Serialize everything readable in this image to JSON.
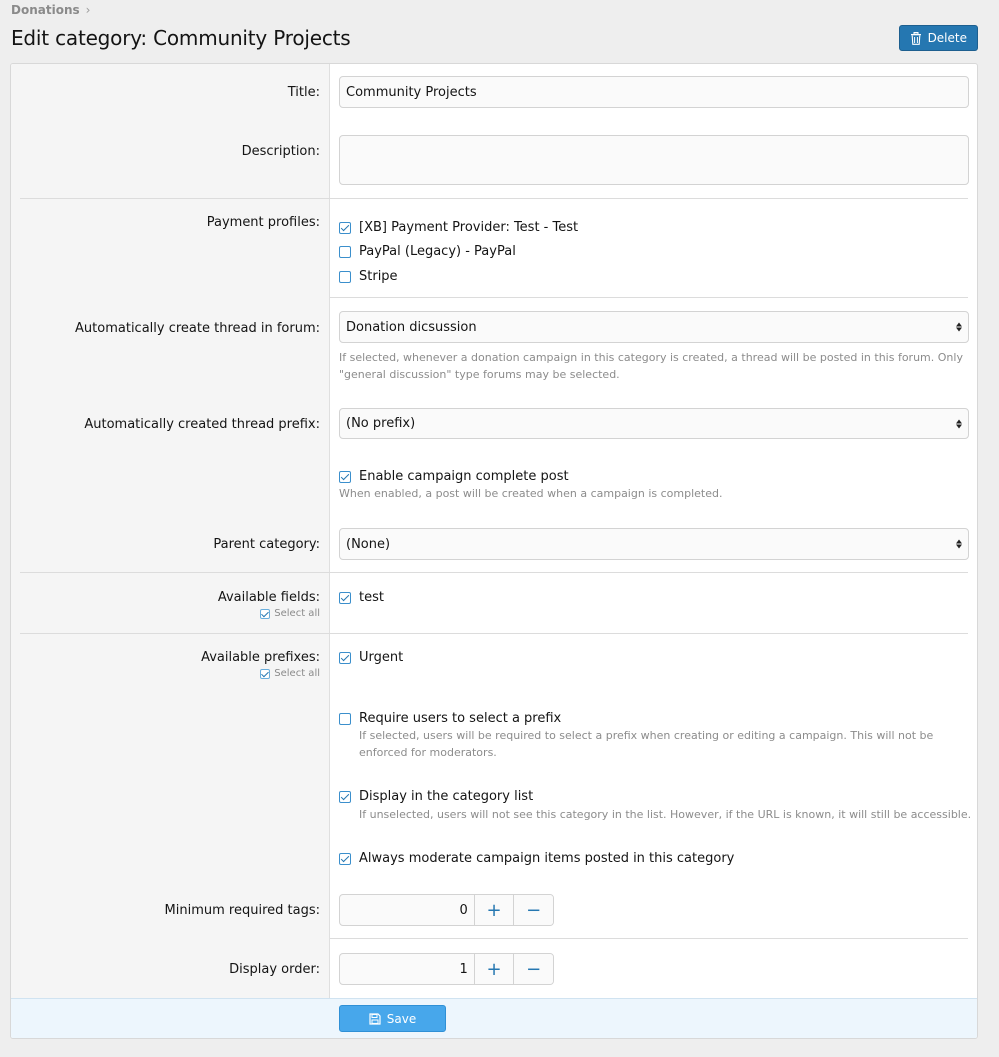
{
  "breadcrumb": {
    "item": "Donations"
  },
  "page": {
    "title": "Edit category: Community Projects"
  },
  "toolbar": {
    "delete_label": "Delete"
  },
  "form": {
    "title": {
      "label": "Title:",
      "value": "Community Projects"
    },
    "description": {
      "label": "Description:",
      "value": ""
    },
    "payment_profiles": {
      "label": "Payment profiles:",
      "options": [
        {
          "label": "[XB] Payment Provider: Test - Test",
          "checked": true
        },
        {
          "label": "PayPal (Legacy) - PayPal",
          "checked": false
        },
        {
          "label": "Stripe",
          "checked": false
        }
      ]
    },
    "auto_thread_forum": {
      "label": "Automatically create thread in forum:",
      "value": "Donation dicsussion",
      "hint": "If selected, whenever a donation campaign in this category is created, a thread will be posted in this forum. Only \"general discussion\" type forums may be selected."
    },
    "auto_thread_prefix": {
      "label": "Automatically created thread prefix:",
      "value": "(No prefix)"
    },
    "campaign_complete_post": {
      "label": "Enable campaign complete post",
      "checked": true,
      "hint": "When enabled, a post will be created when a campaign is completed."
    },
    "parent_category": {
      "label": "Parent category:",
      "value": "(None)"
    },
    "available_fields": {
      "label": "Available fields:",
      "select_all": "Select all",
      "options": [
        {
          "label": "test",
          "checked": true
        }
      ]
    },
    "available_prefixes": {
      "label": "Available prefixes:",
      "select_all": "Select all",
      "options": [
        {
          "label": "Urgent",
          "checked": true
        }
      ]
    },
    "require_prefix": {
      "label": "Require users to select a prefix",
      "checked": false,
      "hint": "If selected, users will be required to select a prefix when creating or editing a campaign. This will not be enforced for moderators."
    },
    "display_in_list": {
      "label": "Display in the category list",
      "checked": true,
      "hint": "If unselected, users will not see this category in the list. However, if the URL is known, it will still be accessible."
    },
    "always_moderate": {
      "label": "Always moderate campaign items posted in this category",
      "checked": true
    },
    "min_tags": {
      "label": "Minimum required tags:",
      "value": "0",
      "plus": "+",
      "minus": "−"
    },
    "display_order": {
      "label": "Display order:",
      "value": "1",
      "plus": "+",
      "minus": "−"
    }
  },
  "footer": {
    "save_label": "Save"
  },
  "colors": {
    "accent": "#2577b1",
    "save": "#47a7eb",
    "footer_bg": "#edf6fd"
  },
  "icons": {
    "delete": "trash-icon",
    "save": "floppy-disk-icon",
    "breadcrumb": "chevron-right-icon"
  }
}
